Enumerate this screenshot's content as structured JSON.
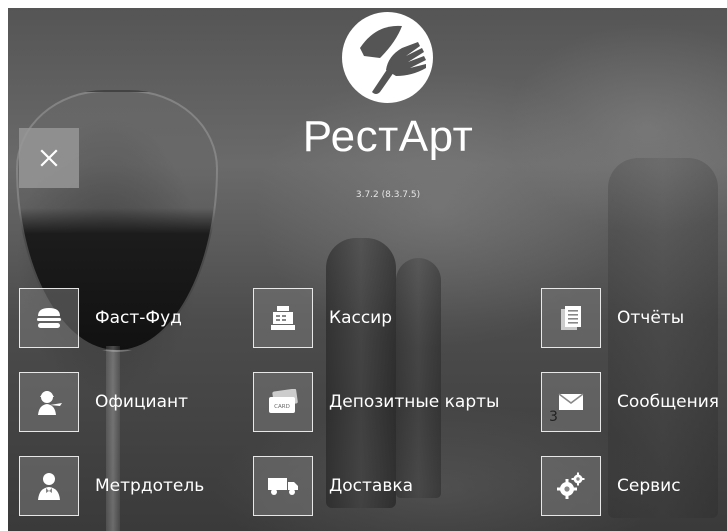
{
  "app": {
    "title": "РестАрт",
    "version": "3.7.2 (8.3.7.5)"
  },
  "menu": {
    "items": [
      {
        "label": "Фаст-Фуд",
        "icon": "burger-icon"
      },
      {
        "label": "Официант",
        "icon": "waiter-icon"
      },
      {
        "label": "Метрдотель",
        "icon": "maitre-d-icon"
      },
      {
        "label": "Кассир",
        "icon": "cash-register-icon"
      },
      {
        "label": "Депозитные карты",
        "icon": "card-icon"
      },
      {
        "label": "Доставка",
        "icon": "truck-icon"
      },
      {
        "label": "Отчёты",
        "icon": "reports-icon"
      },
      {
        "label": "Сообщения",
        "icon": "envelope-icon"
      },
      {
        "label": "Сервис",
        "icon": "gears-icon"
      }
    ]
  },
  "icons": {
    "close": "close-icon",
    "logo": "knife-fork-logo"
  },
  "card_icon_text": "CARD",
  "stray_text": "3",
  "colors": {
    "tile_border": "#ffffff",
    "close_bg": "#969696",
    "text": "#ffffff"
  }
}
